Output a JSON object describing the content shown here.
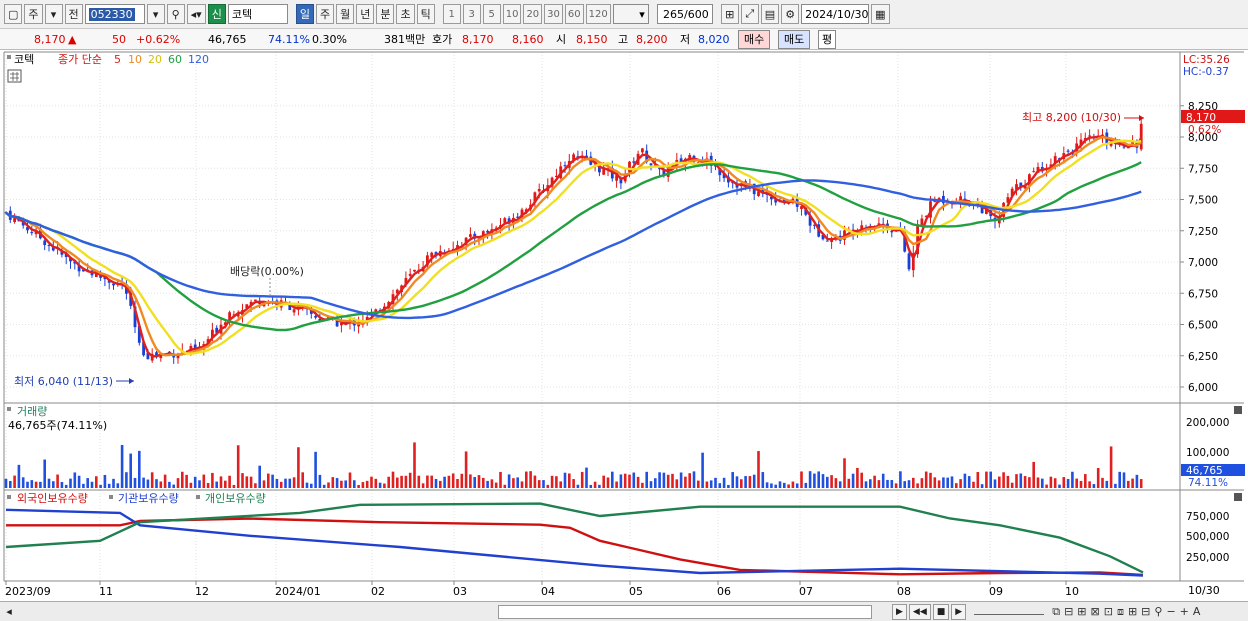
{
  "toolbar": {
    "period_selected": "주",
    "prev_label": "전",
    "stock_code": "052330",
    "market_badge": "신",
    "stock_name": "코텍",
    "periods": [
      "일",
      "주",
      "월",
      "년",
      "분",
      "초",
      "틱"
    ],
    "intervals": [
      "1",
      "3",
      "5",
      "10",
      "20",
      "30",
      "60",
      "120"
    ],
    "count_current": "265",
    "count_max": "/600",
    "date": "2024/10/30"
  },
  "quote": {
    "price": "8,170",
    "change_arrow": "▲",
    "change": "50",
    "change_pct": "+0.62%",
    "volume": "46,765",
    "volume_ratio": "74.11%",
    "turnover": "0.30%",
    "amount": "381백만",
    "ask_label": "호가",
    "ask": "8,170",
    "bid": "8,160",
    "open_label": "시",
    "open": "8,150",
    "high_label": "고",
    "high": "8,200",
    "low_label": "저",
    "low": "8,020",
    "buy_label": "매수",
    "sell_label": "매도",
    "avg_label": "평"
  },
  "price_panel": {
    "name": "코텍",
    "ma_title": "종가 단순",
    "ma_periods": [
      "5",
      "10",
      "20",
      "60",
      "120"
    ],
    "ma_colors": [
      "#e02020",
      "#f08a20",
      "#f0e020",
      "#20a040",
      "#3060e0"
    ],
    "lc": "LC:35.26",
    "hc": "HC:-0.37",
    "y_ticks": [
      "8,250",
      "8,000",
      "7,750",
      "7,500",
      "7,250",
      "7,000",
      "6,750",
      "6,500",
      "6,250",
      "6,000"
    ],
    "current_tag": "8,170",
    "current_pct": "0.62%",
    "high_note": "최고 8,200 (10/30)",
    "low_note": "최저 6,040 (11/13)",
    "dividend_note": "배당락(0.00%)"
  },
  "volume_panel": {
    "title": "거래량",
    "value": "46,765주(74.11%)",
    "y_ticks": [
      "200,000",
      "100,000"
    ],
    "current_tag": "46,765",
    "current_pct": "74.11%"
  },
  "holding_panel": {
    "legends": [
      "외국인보유수량",
      "기관보유수량",
      "개인보유수량"
    ],
    "legend_colors": [
      "#d01010",
      "#2040d0",
      "#208050"
    ],
    "y_ticks": [
      "750,000",
      "500,000",
      "250,000"
    ]
  },
  "x_axis": [
    "2023/09",
    "11",
    "12",
    "2024/01",
    "02",
    "03",
    "04",
    "05",
    "06",
    "07",
    "08",
    "09",
    "10"
  ],
  "x_axis_end": "10/30",
  "icons": [
    "chart-type-icon",
    "dropdown-icon",
    "search-icon",
    "speaker-icon",
    "calendar-icon",
    "crosshair-icon",
    "save-icon",
    "gear-icon",
    "grid-icon",
    "scroll-left-icon",
    "play-icon",
    "stop-icon",
    "zoom-icon"
  ]
}
